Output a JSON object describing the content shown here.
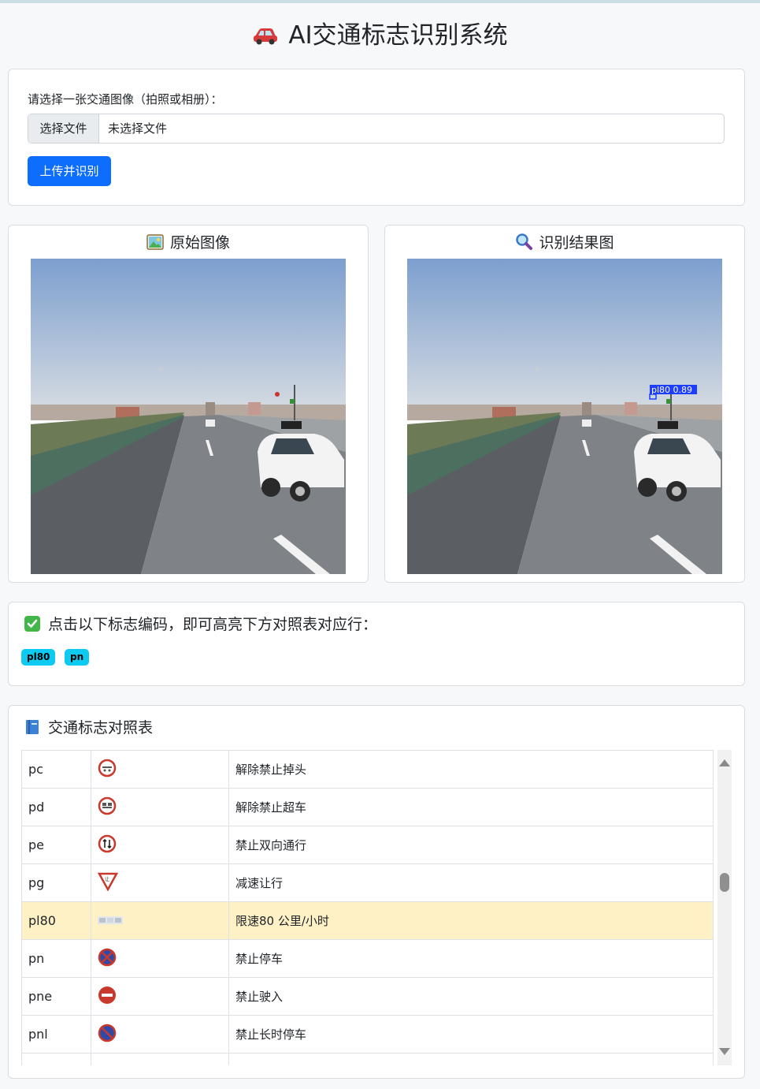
{
  "header": {
    "title": "AI交通标志识别系统",
    "icon": "car-icon"
  },
  "upload": {
    "label": "请选择一张交通图像（拍照或相册）：",
    "choose_button": "选择文件",
    "file_status": "未选择文件",
    "submit_button": "上传并识别"
  },
  "images": {
    "original_title": "原始图像",
    "original_icon": "picture-icon",
    "result_title": "识别结果图",
    "result_icon": "magnifier-icon",
    "detection_label": "pl80 0.89"
  },
  "detected": {
    "hint": "点击以下标志编码，即可高亮下方对照表对应行：",
    "hint_icon": "check-mark-icon",
    "codes": [
      "pl80",
      "pn"
    ]
  },
  "reference_table": {
    "title": "交通标志对照表",
    "title_icon": "book-icon",
    "rows": [
      {
        "code": "pc",
        "icon": "no-u-turn-end-sign",
        "desc": "解除禁止掉头"
      },
      {
        "code": "pd",
        "icon": "no-overtaking-end-sign",
        "desc": "解除禁止超车"
      },
      {
        "code": "pe",
        "icon": "no-two-way-traffic-sign",
        "desc": "禁止双向通行"
      },
      {
        "code": "pg",
        "icon": "yield-sign",
        "desc": "减速让行"
      },
      {
        "code": "pl80",
        "icon": "speed-limit-80-sign",
        "desc": "限速80 公里/小时",
        "highlighted": true
      },
      {
        "code": "pn",
        "icon": "no-parking-sign",
        "desc": "禁止停车"
      },
      {
        "code": "pne",
        "icon": "no-entry-sign",
        "desc": "禁止驶入"
      },
      {
        "code": "pnl",
        "icon": "no-long-parking-sign",
        "desc": "禁止长时停车"
      }
    ]
  },
  "colors": {
    "primary": "#0d6efd",
    "badge": "#0dcaf0",
    "highlight_row": "#fff1c6",
    "sign_red": "#c8382c",
    "sign_blue": "#2f49a8"
  }
}
